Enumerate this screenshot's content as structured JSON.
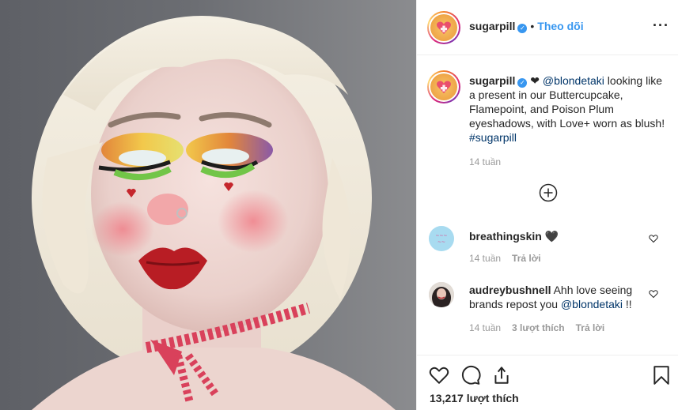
{
  "post": {
    "username": "sugarpill",
    "follow_label": "Theo dõi",
    "more_icon": "more-options-icon"
  },
  "caption": {
    "username": "sugarpill",
    "heart": "❤",
    "mention": "@blondetaki",
    "text": " looking like a present in our Buttercupcake, Flamepoint, and Poison Plum eyeshadows, with Love+ worn as blush! ",
    "hashtag": "#sugarpill",
    "time": "14 tuần"
  },
  "comments": [
    {
      "username": "breathingskin",
      "text": "🖤",
      "time": "14 tuần",
      "reply_label": "Trả lời"
    },
    {
      "username": "audreybushnell",
      "text_before": " Ahh love seeing brands repost you ",
      "mention": "@blondetaki",
      "text_after": " !!",
      "time": "14 tuần",
      "likes_label": "3 lượt thích",
      "reply_label": "Trả lời"
    }
  ],
  "footer": {
    "likes": "13,217 lượt thích"
  },
  "colors": {
    "accent": "#3897f0",
    "link": "#003569",
    "muted": "#999999"
  }
}
